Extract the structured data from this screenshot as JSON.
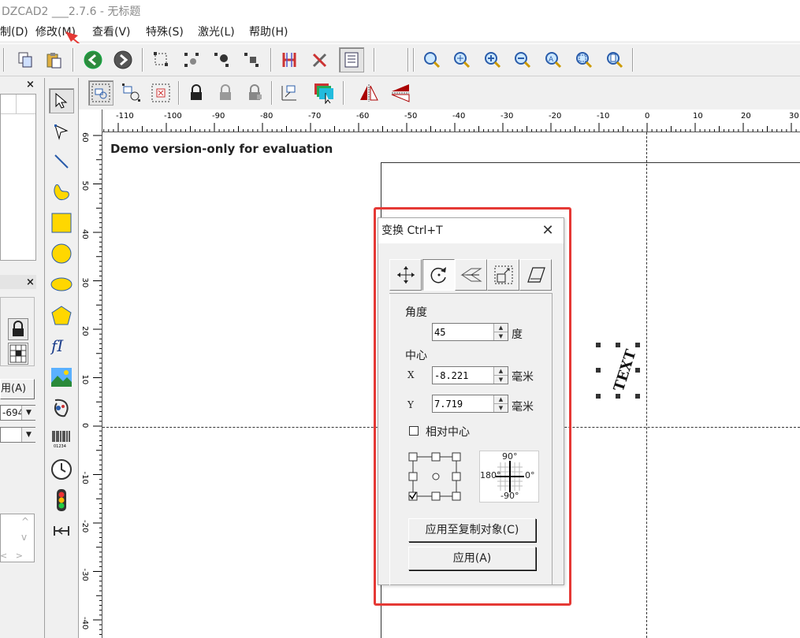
{
  "window": {
    "title": "DZCAD2 ___2.7.6 - 无标题"
  },
  "menu": [
    {
      "label": "制(D)"
    },
    {
      "label": "修改(M)"
    },
    {
      "label": "查看(V)"
    },
    {
      "label": "特殊(S)"
    },
    {
      "label": "激光(L)"
    },
    {
      "label": "帮助(H)"
    }
  ],
  "toolbar_main": [
    "copy-icon",
    "paste-icon",
    "back-icon",
    "forward-icon",
    "node-edit-icon",
    "node-select-icon",
    "node-add-icon",
    "node-delete-icon",
    "hatch-icon",
    "tools-icon",
    "list-icon",
    "zoom-icon",
    "zoom-in-icon",
    "zoom-plus-icon",
    "zoom-minus-icon",
    "zoom-all-icon",
    "zoom-select-icon",
    "zoom-page-icon"
  ],
  "toolbar_second": [
    "group-icon",
    "ungroup-icon",
    "select-inside-icon",
    "lock-icon",
    "unlock-icon",
    "lock-gray-icon",
    "align-icon",
    "layer-color-icon",
    "mirror-h-icon",
    "mirror-v-icon"
  ],
  "left_panel": {
    "apply_label": "用(A)",
    "combo_value": "-694"
  },
  "draw_tools": [
    "pointer-icon",
    "node-tool-icon",
    "line-icon",
    "curve-icon",
    "rectangle-icon",
    "circle-icon",
    "ellipse-icon",
    "polygon-icon",
    "text-icon",
    "bitmap-icon",
    "vector-icon",
    "barcode-icon",
    "timer-icon",
    "input-port-icon",
    "output-port-icon"
  ],
  "ruler": {
    "h_labels": [
      "-110",
      "-100",
      "-90",
      "-80",
      "-70",
      "-60",
      "-50",
      "-40",
      "-30",
      "-20",
      "-10",
      "0",
      "10",
      "20",
      "30"
    ],
    "v_labels": [
      "60",
      "50",
      "40",
      "30",
      "20",
      "10",
      "0",
      "-10",
      "-20",
      "-30",
      "-40"
    ]
  },
  "canvas": {
    "demo_text": "Demo version-only for evaluation",
    "object_text": "TEXT"
  },
  "dialog": {
    "title": "变换  Ctrl+T",
    "tabs": [
      "move-icon",
      "rotate-icon",
      "mirror-icon",
      "scale-icon",
      "skew-icon"
    ],
    "angle_label": "角度",
    "angle_value": "45",
    "angle_unit": "度",
    "center_label": "中心",
    "x_label": "X",
    "x_value": "-8.221",
    "x_unit": "毫米",
    "y_label": "Y",
    "y_value": "7.719",
    "y_unit": "毫米",
    "relative_label": "相对中心",
    "relative_checked": false,
    "dial_top": "90°",
    "dial_left": "180°",
    "dial_right": "0°",
    "dial_bottom": "-90°",
    "apply_copy_label": "应用至复制对象(C)",
    "apply_label": "应用(A)"
  },
  "colors": {
    "highlight": "#e53935",
    "accent_yellow": "#ffd700",
    "handle": "#333333"
  }
}
